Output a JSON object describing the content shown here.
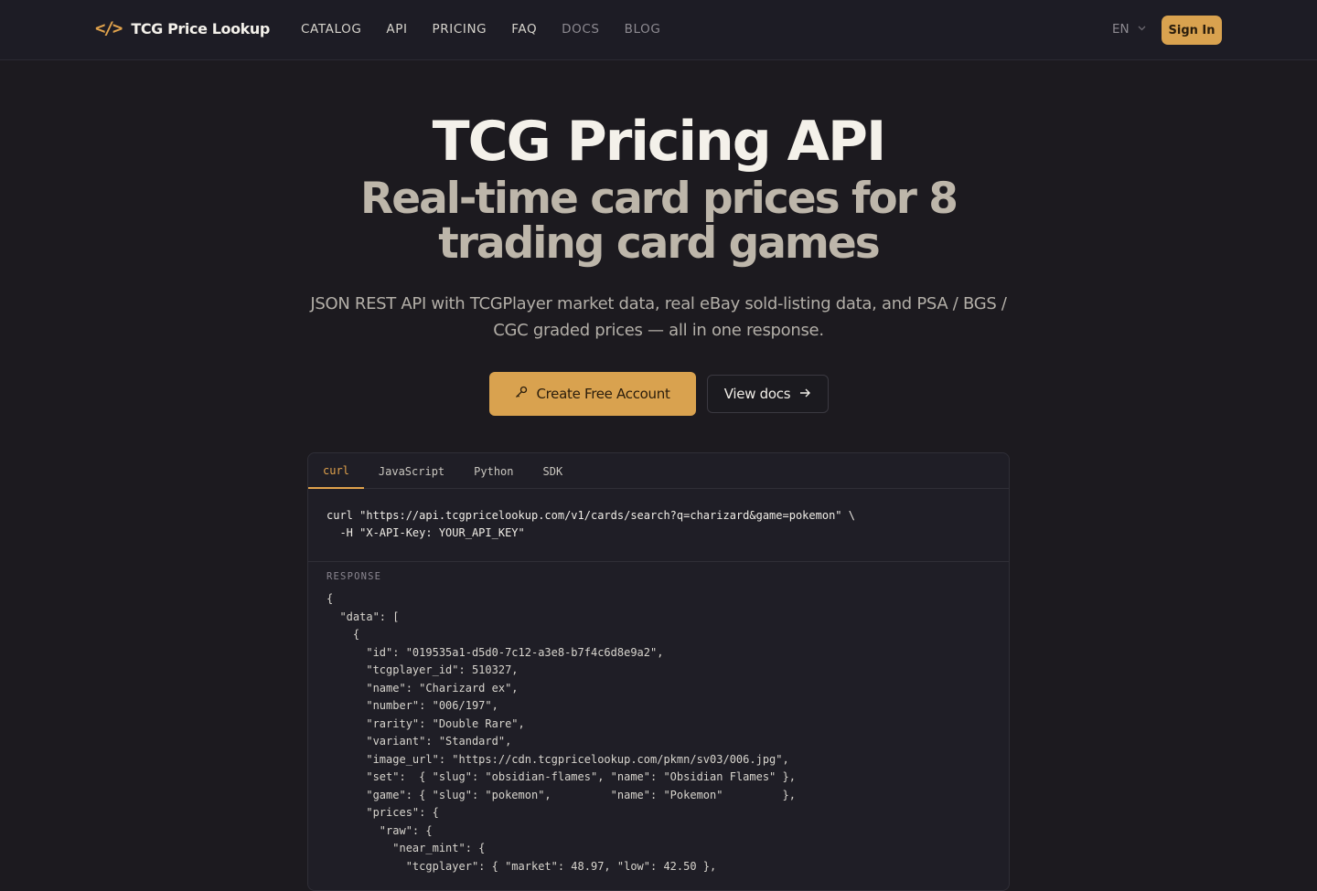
{
  "nav": {
    "logo_icon": "</>",
    "brand": "TCG Price Lookup",
    "links": [
      "CATALOG",
      "API",
      "PRICING",
      "FAQ",
      "DOCS",
      "BLOG"
    ],
    "language": "EN",
    "sign_in": "Sign In"
  },
  "hero": {
    "title": "TCG Pricing API",
    "subtitle": "Real-time card prices for 8 trading card games",
    "description": "JSON REST API with TCGPlayer market data, real eBay sold-listing data, and PSA / BGS / CGC graded prices — all in one response.",
    "primary_cta": "Create Free Account",
    "secondary_cta": "View docs"
  },
  "code_panel": {
    "tabs": [
      "curl",
      "JavaScript",
      "Python",
      "SDK"
    ],
    "active_tab": "curl",
    "request": "curl \"https://api.tcgpricelookup.com/v1/cards/search?q=charizard&game=pokemon\" \\\n  -H \"X-API-Key: YOUR_API_KEY\"",
    "response_label": "RESPONSE",
    "response": "{\n  \"data\": [\n    {\n      \"id\": \"019535a1-d5d0-7c12-a3e8-b7f4c6d8e9a2\",\n      \"tcgplayer_id\": 510327,\n      \"name\": \"Charizard ex\",\n      \"number\": \"006/197\",\n      \"rarity\": \"Double Rare\",\n      \"variant\": \"Standard\",\n      \"image_url\": \"https://cdn.tcgpricelookup.com/pkmn/sv03/006.jpg\",\n      \"set\":  { \"slug\": \"obsidian-flames\", \"name\": \"Obsidian Flames\" },\n      \"game\": { \"slug\": \"pokemon\",         \"name\": \"Pokemon\"         },\n      \"prices\": {\n        \"raw\": {\n          \"near_mint\": {\n            \"tcgplayer\": { \"market\": 48.97, \"low\": 42.50 },"
  },
  "colors": {
    "accent": "#d9a24f",
    "background": "#1c1a1f",
    "nav_background": "#1d1c25"
  },
  "icons": {
    "logo": "code-brackets-icon",
    "language_chevron": "chevron-down-icon",
    "primary_cta": "key-icon",
    "secondary_cta": "arrow-right-icon"
  }
}
